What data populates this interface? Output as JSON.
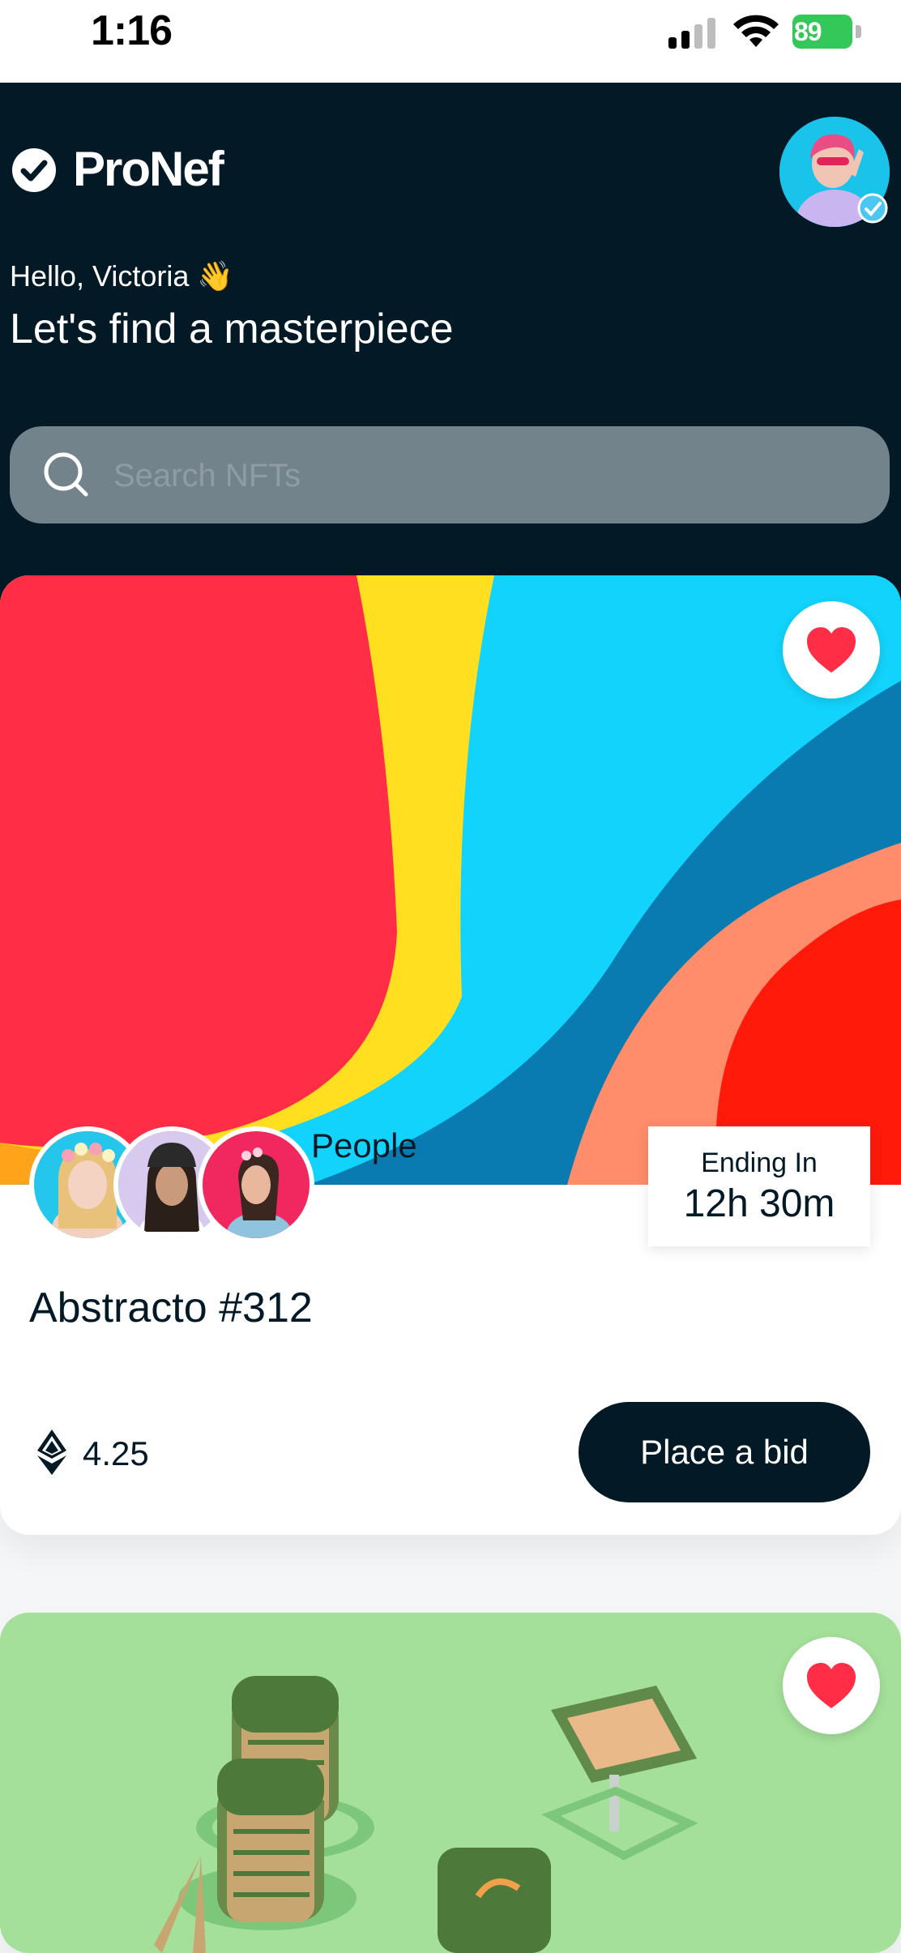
{
  "status_bar": {
    "time": "1:16",
    "battery": "89"
  },
  "header": {
    "logo": "ProNef",
    "greeting": "Hello, Victoria 👋",
    "tagline": "Let's find a masterpiece"
  },
  "search": {
    "placeholder": "Search NFTs"
  },
  "cards": [
    {
      "people_label": "People",
      "ending_label": "Ending In",
      "ending_value": "12h 30m",
      "title": "Abstracto #312",
      "price": "4.25",
      "bid_label": "Place a bid",
      "favorited": true
    },
    {
      "favorited": true
    }
  ],
  "colors": {
    "header_bg": "#031a26",
    "accent_red": "#ff2d45",
    "button_bg": "#031a26",
    "battery": "#34c759"
  },
  "icons": [
    "check-badge-icon",
    "search-icon",
    "heart-icon",
    "ethereum-icon",
    "wifi-icon",
    "signal-icon",
    "battery-icon"
  ]
}
